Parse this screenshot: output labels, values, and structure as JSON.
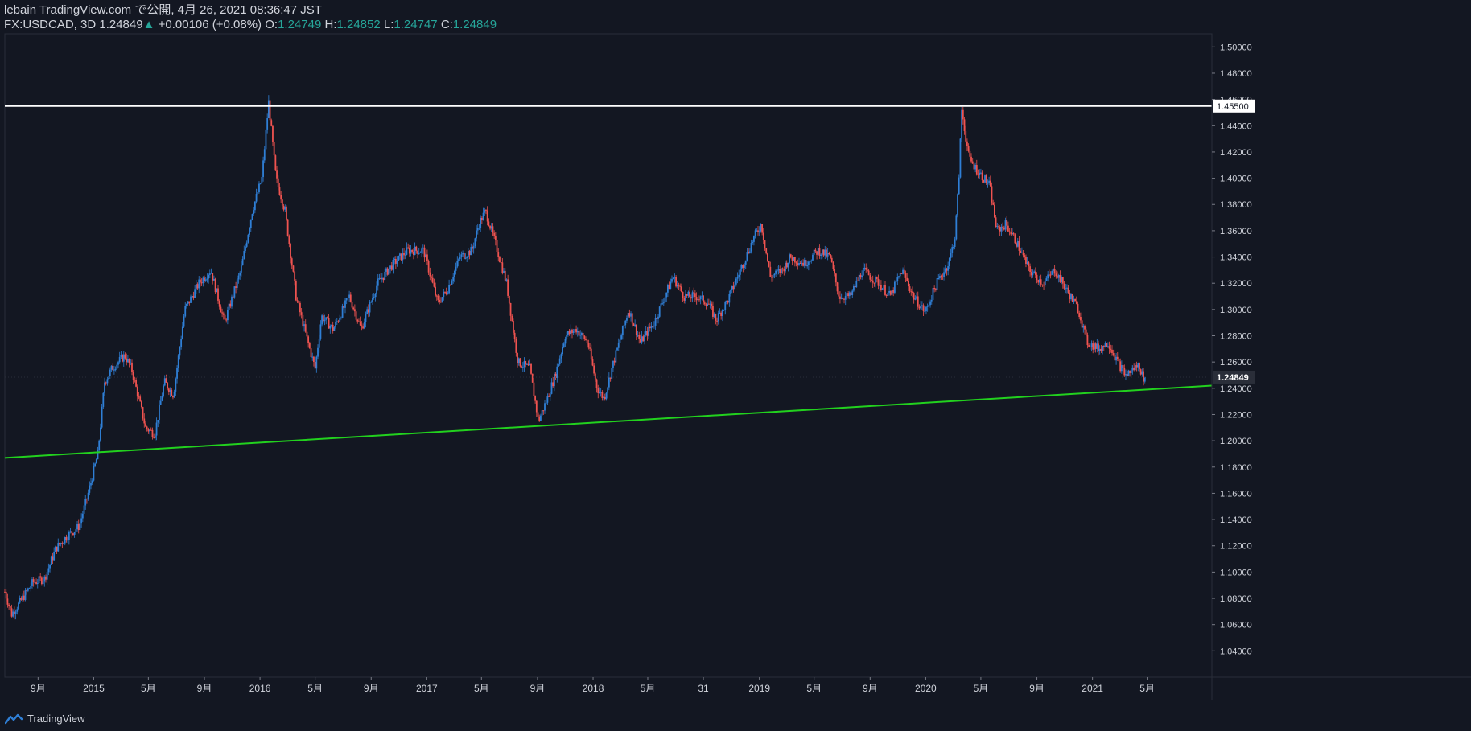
{
  "header": {
    "publish_line": "lebain TradingView.com で公開, 4月 26, 2021 08:36:47 JST",
    "symbol": "FX:USDCAD, 3D",
    "last": "1.24849",
    "change_arrow": "▲",
    "change": "+0.00106 (+0.08%)",
    "o_label": "O:",
    "o_value": "1.24749",
    "h_label": "H:",
    "h_value": "1.24852",
    "l_label": "L:",
    "l_value": "1.24747",
    "c_label": "C:",
    "c_value": "1.24849"
  },
  "footer": {
    "brand": "TradingView",
    "logo_icon": "tradingview-logo-icon"
  },
  "colors": {
    "background": "#131722",
    "up": "#2f7fd6",
    "down": "#ef5350",
    "resistance": "#ffffff",
    "support": "#22d11e",
    "text": "#d1d4dc",
    "grid_line": "#2a2e39"
  },
  "chart_data": {
    "type": "candlestick",
    "symbol": "USDCAD",
    "timeframe": "3D",
    "ylim": [
      1.02,
      1.51
    ],
    "y_ticks": [
      1.04,
      1.06,
      1.08,
      1.1,
      1.12,
      1.14,
      1.16,
      1.18,
      1.2,
      1.22,
      1.24,
      1.26,
      1.28,
      1.3,
      1.32,
      1.34,
      1.36,
      1.38,
      1.4,
      1.42,
      1.44,
      1.46,
      1.48,
      1.5
    ],
    "y_tick_labels": [
      "1.04000",
      "1.06000",
      "1.08000",
      "1.10000",
      "1.12000",
      "1.14000",
      "1.16000",
      "1.18000",
      "1.20000",
      "1.22000",
      "1.24000",
      "1.26000",
      "1.28000",
      "1.30000",
      "1.32000",
      "1.34000",
      "1.36000",
      "1.38000",
      "1.40000",
      "1.42000",
      "1.44000",
      "1.46000",
      "1.48000",
      "1.50000"
    ],
    "x_ticks": [
      {
        "label": "9月",
        "date": "2014-09-01"
      },
      {
        "label": "2015",
        "date": "2015-01-01"
      },
      {
        "label": "5月",
        "date": "2015-05-01"
      },
      {
        "label": "9月",
        "date": "2015-09-01"
      },
      {
        "label": "2016",
        "date": "2016-01-01"
      },
      {
        "label": "5月",
        "date": "2016-05-01"
      },
      {
        "label": "9月",
        "date": "2016-09-01"
      },
      {
        "label": "2017",
        "date": "2017-01-01"
      },
      {
        "label": "5月",
        "date": "2017-05-01"
      },
      {
        "label": "9月",
        "date": "2017-09-01"
      },
      {
        "label": "2018",
        "date": "2018-01-01"
      },
      {
        "label": "5月",
        "date": "2018-05-01"
      },
      {
        "label": "31",
        "date": "2018-08-31"
      },
      {
        "label": "2019",
        "date": "2019-01-01"
      },
      {
        "label": "5月",
        "date": "2019-05-01"
      },
      {
        "label": "9月",
        "date": "2019-09-01"
      },
      {
        "label": "2020",
        "date": "2020-01-01"
      },
      {
        "label": "5月",
        "date": "2020-05-01"
      },
      {
        "label": "9月",
        "date": "2020-09-01"
      },
      {
        "label": "2021",
        "date": "2021-01-01"
      },
      {
        "label": "5月",
        "date": "2021-05-01"
      }
    ],
    "price_path": [
      [
        "2014-06-20",
        1.085
      ],
      [
        "2014-07-05",
        1.068
      ],
      [
        "2014-07-25",
        1.078
      ],
      [
        "2014-08-20",
        1.092
      ],
      [
        "2014-09-15",
        1.095
      ],
      [
        "2014-10-10",
        1.118
      ],
      [
        "2014-11-05",
        1.128
      ],
      [
        "2014-11-30",
        1.135
      ],
      [
        "2014-12-20",
        1.16
      ],
      [
        "2015-01-10",
        1.19
      ],
      [
        "2015-01-25",
        1.245
      ],
      [
        "2015-02-10",
        1.255
      ],
      [
        "2015-03-10",
        1.265
      ],
      [
        "2015-03-25",
        1.255
      ],
      [
        "2015-04-25",
        1.21
      ],
      [
        "2015-05-15",
        1.205
      ],
      [
        "2015-06-05",
        1.245
      ],
      [
        "2015-06-25",
        1.235
      ],
      [
        "2015-07-20",
        1.3
      ],
      [
        "2015-08-20",
        1.32
      ],
      [
        "2015-09-15",
        1.33
      ],
      [
        "2015-10-15",
        1.29
      ],
      [
        "2015-11-20",
        1.33
      ],
      [
        "2015-12-15",
        1.375
      ],
      [
        "2016-01-05",
        1.4
      ],
      [
        "2016-01-20",
        1.458
      ],
      [
        "2016-02-05",
        1.4
      ],
      [
        "2016-02-25",
        1.375
      ],
      [
        "2016-03-20",
        1.31
      ],
      [
        "2016-04-15",
        1.275
      ],
      [
        "2016-05-01",
        1.255
      ],
      [
        "2016-05-15",
        1.295
      ],
      [
        "2016-06-10",
        1.285
      ],
      [
        "2016-07-15",
        1.31
      ],
      [
        "2016-08-10",
        1.285
      ],
      [
        "2016-09-15",
        1.32
      ],
      [
        "2016-10-20",
        1.335
      ],
      [
        "2016-11-20",
        1.345
      ],
      [
        "2016-12-25",
        1.345
      ],
      [
        "2017-01-25",
        1.305
      ],
      [
        "2017-02-15",
        1.315
      ],
      [
        "2017-03-15",
        1.34
      ],
      [
        "2017-04-10",
        1.345
      ],
      [
        "2017-04-25",
        1.365
      ],
      [
        "2017-05-10",
        1.375
      ],
      [
        "2017-06-05",
        1.345
      ],
      [
        "2017-06-25",
        1.32
      ],
      [
        "2017-07-20",
        1.26
      ],
      [
        "2017-08-15",
        1.255
      ],
      [
        "2017-09-03",
        1.215
      ],
      [
        "2017-09-20",
        1.23
      ],
      [
        "2017-10-10",
        1.25
      ],
      [
        "2017-11-01",
        1.28
      ],
      [
        "2017-11-25",
        1.285
      ],
      [
        "2017-12-20",
        1.275
      ],
      [
        "2018-01-10",
        1.24
      ],
      [
        "2018-01-25",
        1.232
      ],
      [
        "2018-02-15",
        1.26
      ],
      [
        "2018-03-20",
        1.3
      ],
      [
        "2018-04-15",
        1.275
      ],
      [
        "2018-05-15",
        1.29
      ],
      [
        "2018-06-25",
        1.325
      ],
      [
        "2018-07-20",
        1.31
      ],
      [
        "2018-08-15",
        1.31
      ],
      [
        "2018-09-10",
        1.305
      ],
      [
        "2018-09-28",
        1.292
      ],
      [
        "2018-10-25",
        1.308
      ],
      [
        "2018-11-20",
        1.33
      ],
      [
        "2018-12-20",
        1.355
      ],
      [
        "2019-01-05",
        1.365
      ],
      [
        "2019-01-25",
        1.325
      ],
      [
        "2019-02-20",
        1.33
      ],
      [
        "2019-03-10",
        1.34
      ],
      [
        "2019-04-10",
        1.335
      ],
      [
        "2019-05-10",
        1.345
      ],
      [
        "2019-06-05",
        1.34
      ],
      [
        "2019-06-25",
        1.31
      ],
      [
        "2019-07-20",
        1.31
      ],
      [
        "2019-08-15",
        1.33
      ],
      [
        "2019-09-20",
        1.32
      ],
      [
        "2019-10-15",
        1.31
      ],
      [
        "2019-11-10",
        1.33
      ],
      [
        "2019-12-05",
        1.31
      ],
      [
        "2019-12-31",
        1.298
      ],
      [
        "2020-01-25",
        1.32
      ],
      [
        "2020-02-20",
        1.335
      ],
      [
        "2020-03-05",
        1.355
      ],
      [
        "2020-03-13",
        1.395
      ],
      [
        "2020-03-20",
        1.452
      ],
      [
        "2020-04-05",
        1.415
      ],
      [
        "2020-04-25",
        1.405
      ],
      [
        "2020-05-20",
        1.395
      ],
      [
        "2020-06-05",
        1.36
      ],
      [
        "2020-06-25",
        1.365
      ],
      [
        "2020-07-20",
        1.35
      ],
      [
        "2020-08-15",
        1.33
      ],
      [
        "2020-09-15",
        1.32
      ],
      [
        "2020-10-10",
        1.33
      ],
      [
        "2020-11-05",
        1.315
      ],
      [
        "2020-12-01",
        1.3
      ],
      [
        "2020-12-20",
        1.275
      ],
      [
        "2021-01-15",
        1.27
      ],
      [
        "2021-02-05",
        1.275
      ],
      [
        "2021-02-25",
        1.26
      ],
      [
        "2021-03-15",
        1.25
      ],
      [
        "2021-04-01",
        1.255
      ],
      [
        "2021-04-13",
        1.258
      ],
      [
        "2021-04-22",
        1.248
      ],
      [
        "2021-04-26",
        1.24849
      ]
    ],
    "horizontal_line": {
      "price": 1.455,
      "label": "1.45500"
    },
    "trendline": {
      "start": {
        "date": "2014-06-20",
        "price": 1.187
      },
      "end": {
        "date": "2021-09-20",
        "price": 1.242
      }
    },
    "last_price_label": "1.24849",
    "current_price": 1.24849,
    "x_range": [
      "2014-06-20",
      "2021-09-20"
    ]
  }
}
